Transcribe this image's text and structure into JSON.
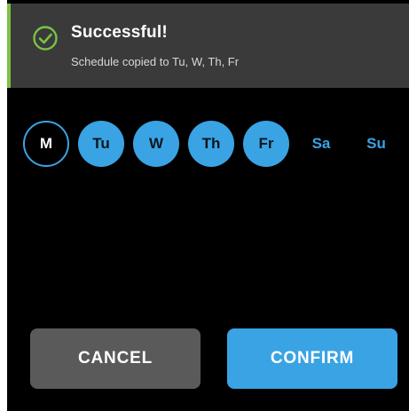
{
  "toast": {
    "icon": "check-circle-icon",
    "title": "Successful!",
    "message": "Schedule copied to Tu, W, Th, Fr",
    "accent_color": "#7bc144"
  },
  "days": [
    {
      "label": "M",
      "state": "current"
    },
    {
      "label": "Tu",
      "state": "selected"
    },
    {
      "label": "W",
      "state": "selected"
    },
    {
      "label": "Th",
      "state": "selected"
    },
    {
      "label": "Fr",
      "state": "selected"
    },
    {
      "label": "Sa",
      "state": "unselected"
    },
    {
      "label": "Su",
      "state": "unselected"
    }
  ],
  "buttons": {
    "cancel_label": "CANCEL",
    "confirm_label": "CONFIRM"
  },
  "colors": {
    "accent": "#3aa3e3",
    "background": "#000000",
    "toast_background": "#3a3a3a",
    "cancel_background": "#5a5a5a"
  }
}
